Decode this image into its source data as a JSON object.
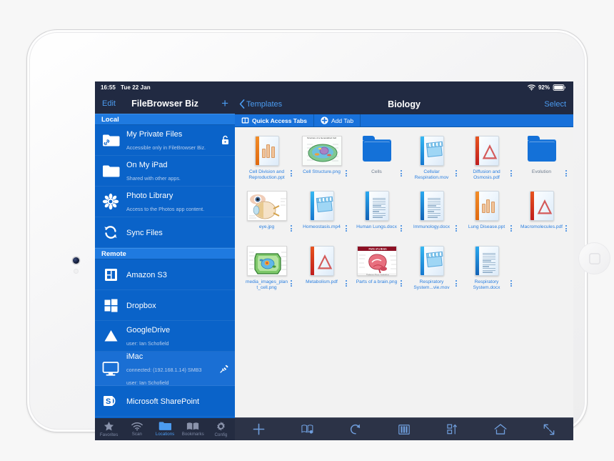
{
  "status_bar": {
    "time": "16:55",
    "date": "Tue 22 Jan",
    "battery_percent": "92%",
    "wifi_icon": "wifi-icon",
    "battery_icon": "battery-icon"
  },
  "sidebar": {
    "nav": {
      "edit_label": "Edit",
      "title": "FileBrowser Biz",
      "add_label": "+"
    },
    "sections": [
      {
        "header": "Local",
        "items": [
          {
            "title": "My Private Files",
            "subtitle": "Accessible only in FileBrowser Biz.",
            "icon": "folder-link-icon",
            "accessory": "lock-icon",
            "selected": false
          },
          {
            "title": "On My iPad",
            "subtitle": "Shared with other apps.",
            "icon": "folder-icon",
            "accessory": "",
            "selected": false
          },
          {
            "title": "Photo Library",
            "subtitle": "Access to the Photos app content.",
            "icon": "photos-flower-icon",
            "accessory": "",
            "selected": false
          },
          {
            "title": "Sync Files",
            "subtitle": "",
            "icon": "sync-arrows-icon",
            "accessory": "",
            "selected": false
          }
        ]
      },
      {
        "header": "Remote",
        "items": [
          {
            "title": "Amazon S3",
            "subtitle": "",
            "icon": "amazon-s3-icon",
            "accessory": "",
            "selected": false
          },
          {
            "title": "Dropbox",
            "subtitle": "",
            "icon": "windows-squares-icon",
            "accessory": "",
            "selected": false
          },
          {
            "title": "GoogleDrive",
            "subtitle": "user: Ian Schofield",
            "icon": "google-drive-icon",
            "accessory": "",
            "selected": false
          },
          {
            "title": "iMac",
            "subtitle": "connected: (192.168.1.14) SMB3",
            "subtitle2": "user: Ian Schofield",
            "icon": "imac-monitor-icon",
            "accessory": "eject-plug-icon",
            "selected": true
          },
          {
            "title": "Microsoft SharePoint",
            "subtitle": "",
            "icon": "sharepoint-icon",
            "accessory": "",
            "selected": false
          }
        ]
      }
    ],
    "tabbar": [
      {
        "label": "Favorites",
        "icon": "star-icon",
        "active": false
      },
      {
        "label": "Scan",
        "icon": "wifi-scan-icon",
        "active": false
      },
      {
        "label": "Locations",
        "icon": "folder-icon",
        "active": true
      },
      {
        "label": "Bookmarks",
        "icon": "book-icon",
        "active": false
      },
      {
        "label": "Config",
        "icon": "gear-icon",
        "active": false
      }
    ]
  },
  "main": {
    "nav": {
      "back_label": "Templates",
      "title": "Biology",
      "select_label": "Select"
    },
    "tabstrip": [
      {
        "label": "Quick Access Tabs",
        "icon": "tabs-icon"
      },
      {
        "label": "Add Tab",
        "icon": "plus-circle-icon"
      }
    ],
    "files": [
      {
        "name": "Cell Division and Reproduction.ppt",
        "kind": "ppt"
      },
      {
        "name": "Cell Structure.png",
        "kind": "image",
        "caption": "Structure of a Generalized Cell"
      },
      {
        "name": "Cells",
        "kind": "folder"
      },
      {
        "name": "Cellular Respiration.mov",
        "kind": "mov"
      },
      {
        "name": "Diffusion and Osmosis.pdf",
        "kind": "pdf"
      },
      {
        "name": "Evolution",
        "kind": "folder"
      },
      {
        "name": "eye.jpg",
        "kind": "image",
        "caption": ""
      },
      {
        "name": "Homeostasis.mp4",
        "kind": "mov"
      },
      {
        "name": "Human Lungs.docx",
        "kind": "docx"
      },
      {
        "name": "Immunology.docx",
        "kind": "docx"
      },
      {
        "name": "Lung Disease.ppt",
        "kind": "ppt"
      },
      {
        "name": "Macromolecules.pdf",
        "kind": "pdf"
      },
      {
        "name": "media_images_plant_cell.png",
        "kind": "image",
        "caption": ""
      },
      {
        "name": "Metabolism.pdf",
        "kind": "pdf"
      },
      {
        "name": "Parts of a brain.png",
        "kind": "image",
        "caption": "Parts of a Brain"
      },
      {
        "name": "Respiratory System...vie.mov",
        "kind": "mov"
      },
      {
        "name": "Respiratory System.docx",
        "kind": "docx"
      }
    ],
    "toolbar": [
      {
        "icon": "plus-icon",
        "name": "new-item-button"
      },
      {
        "icon": "bookmark-add-icon",
        "name": "add-bookmark-button"
      },
      {
        "icon": "refresh-icon",
        "name": "refresh-button"
      },
      {
        "icon": "column-view-icon",
        "name": "view-mode-button"
      },
      {
        "icon": "sort-icon",
        "name": "sort-button"
      },
      {
        "icon": "home-icon",
        "name": "home-button"
      },
      {
        "icon": "expand-arrows-icon",
        "name": "fullscreen-button"
      }
    ]
  },
  "colors": {
    "sidebar_blue": "#0a63c9",
    "navbar_dark": "#212a42",
    "accent_blue": "#4b9bf0",
    "tabstrip_blue": "#1871da"
  }
}
